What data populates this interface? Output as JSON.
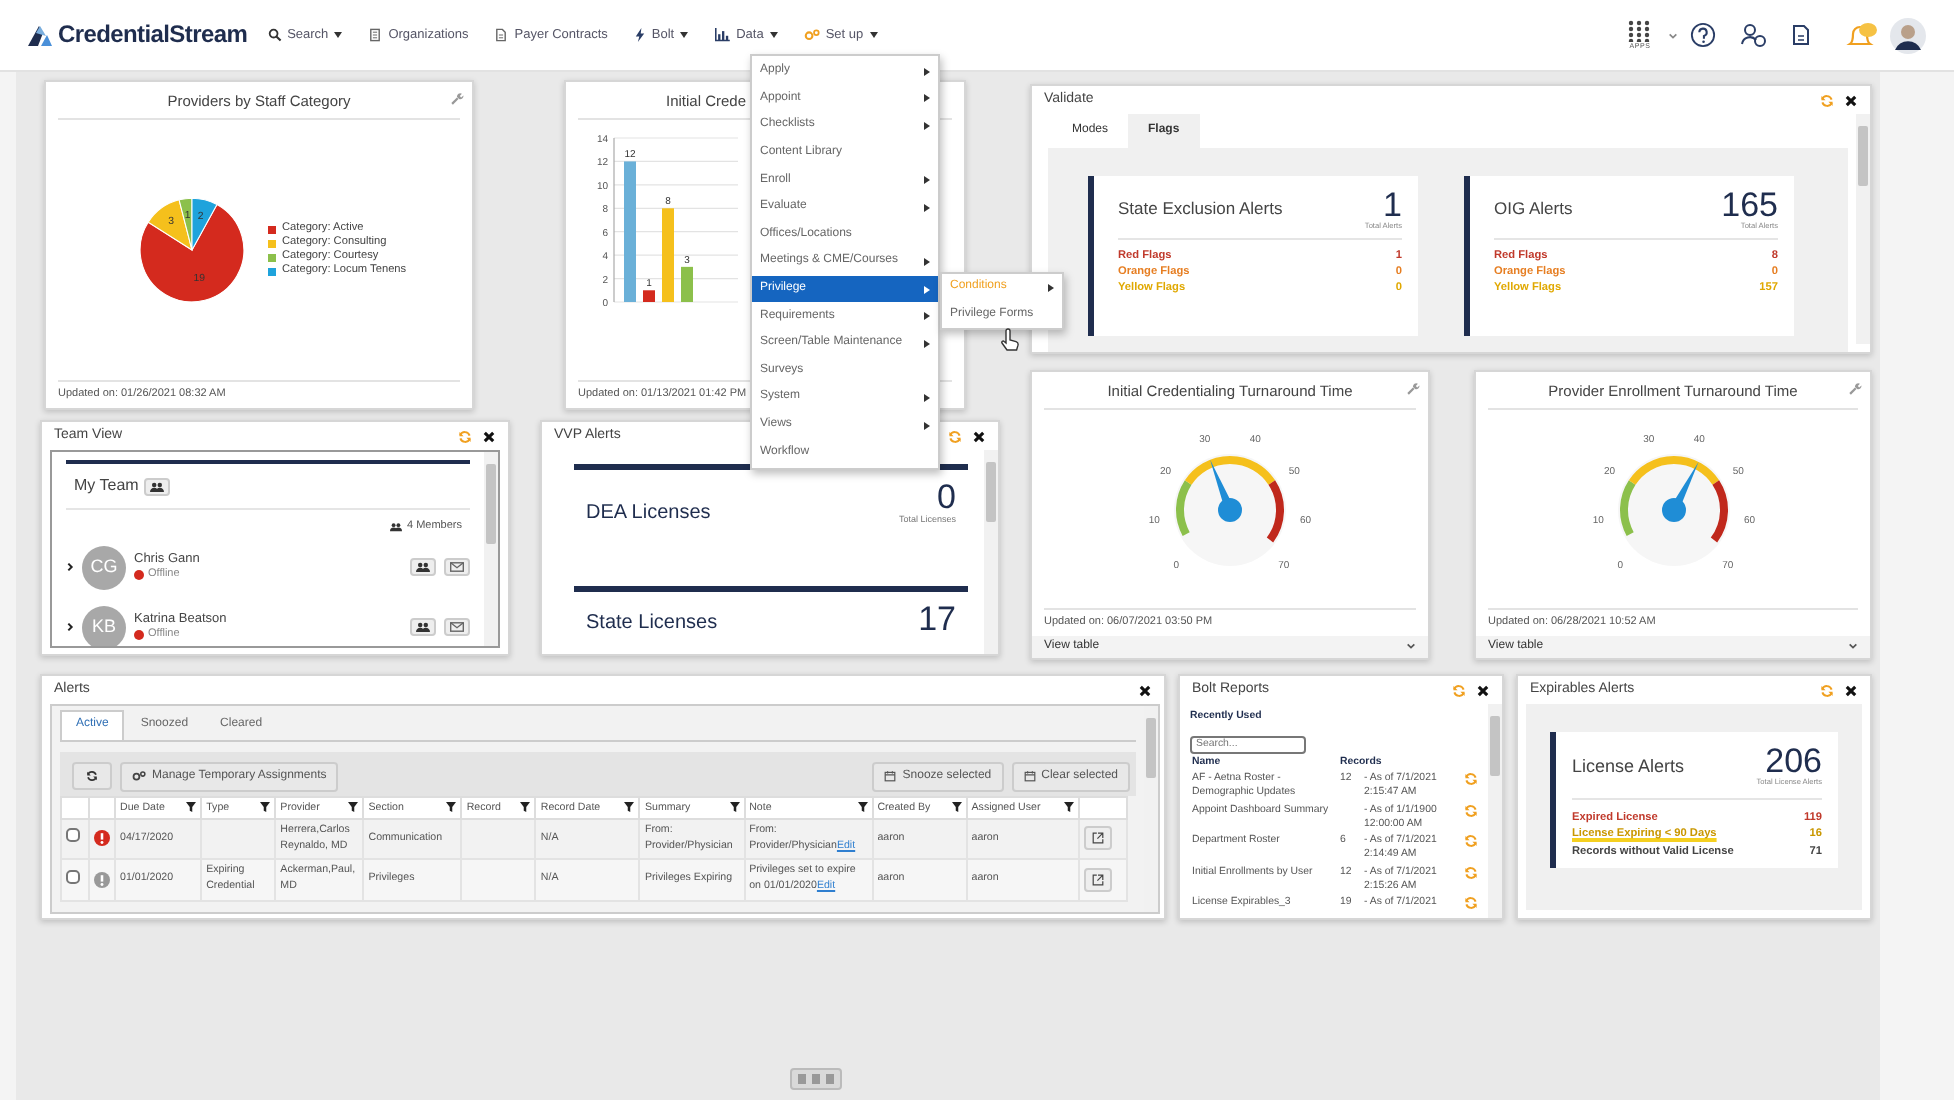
{
  "nav": {
    "brand": "CredentialStream",
    "items": [
      {
        "label": "Search",
        "kind": "search",
        "caret": true
      },
      {
        "label": "Organizations",
        "kind": "building",
        "caret": false
      },
      {
        "label": "Payer Contracts",
        "kind": "doc",
        "caret": false
      },
      {
        "label": "Bolt",
        "kind": "bolt",
        "caret": true
      },
      {
        "label": "Data",
        "kind": "chart",
        "caret": true
      },
      {
        "label": "Set up",
        "kind": "gears",
        "caret": true
      }
    ],
    "apps_label": "APPS"
  },
  "setup_menu": {
    "items": [
      {
        "label": "Apply",
        "submenu": true,
        "selected": false
      },
      {
        "label": "Appoint",
        "submenu": true,
        "selected": false
      },
      {
        "label": "Checklists",
        "submenu": true,
        "selected": false
      },
      {
        "label": "Content Library",
        "submenu": false,
        "selected": false
      },
      {
        "label": "Enroll",
        "submenu": true,
        "selected": false
      },
      {
        "label": "Evaluate",
        "submenu": true,
        "selected": false
      },
      {
        "label": "Offices/Locations",
        "submenu": false,
        "selected": false
      },
      {
        "label": "Meetings & CME/Courses",
        "submenu": true,
        "selected": false
      },
      {
        "label": "Privilege",
        "submenu": true,
        "selected": true
      },
      {
        "label": "Requirements",
        "submenu": true,
        "selected": false
      },
      {
        "label": "Screen/Table Maintenance",
        "submenu": true,
        "selected": false
      },
      {
        "label": "Surveys",
        "submenu": false,
        "selected": false
      },
      {
        "label": "System",
        "submenu": true,
        "selected": false
      },
      {
        "label": "Views",
        "submenu": true,
        "selected": false
      },
      {
        "label": "Workflow",
        "submenu": false,
        "selected": false
      }
    ],
    "submenu": [
      {
        "label": "Conditions",
        "submenu": true,
        "selected": true
      },
      {
        "label": "Privilege Forms",
        "submenu": false,
        "selected": false
      }
    ]
  },
  "staff_category": {
    "title": "Providers by Staff Category",
    "updated": "Updated on: 01/26/2021 08:32 AM",
    "chart_data": {
      "type": "pie",
      "categories": [
        "Category: Active",
        "Category: Consulting",
        "Category: Courtesy",
        "Category: Locum Tenens"
      ],
      "series": [
        {
          "values": [
            19,
            3,
            1,
            2
          ]
        }
      ],
      "colors": [
        "#d42a1e",
        "#f5c01c",
        "#8cc04b",
        "#1fa3dc"
      ],
      "data_labels": true
    }
  },
  "initial_cred": {
    "title": "Initial Crede",
    "updated": "Updated on: 01/13/2021 01:42 PM",
    "chart_data": {
      "type": "bar",
      "ylim": [
        0,
        14
      ],
      "grid": true,
      "yticks": [
        0,
        2,
        4,
        6,
        8,
        10,
        12,
        14
      ],
      "data_labels": true,
      "series": [
        {
          "color": "#6ab0d8",
          "values": [
            12
          ]
        },
        {
          "color": "#d42a1e",
          "values": [
            1
          ]
        },
        {
          "color": "#f5c01c",
          "values": [
            8
          ]
        },
        {
          "color": "#8cc04b",
          "values": [
            3
          ]
        }
      ]
    }
  },
  "validate": {
    "title": "Validate",
    "tabs": [
      {
        "label": "Modes",
        "selected": false
      },
      {
        "label": "Flags",
        "selected": true
      }
    ],
    "cards": [
      {
        "title": "State Exclusion Alerts",
        "total": "1",
        "total_label": "Total Alerts",
        "flags": [
          {
            "label": "Red Flags",
            "count": "1",
            "color": "#c0392b"
          },
          {
            "label": "Orange Flags",
            "count": "0",
            "color": "#e67e22"
          },
          {
            "label": "Yellow Flags",
            "count": "0",
            "color": "#e0a800"
          }
        ]
      },
      {
        "title": "OIG Alerts",
        "total": "165",
        "total_label": "Total Alerts",
        "flags": [
          {
            "label": "Red Flags",
            "count": "8",
            "color": "#c0392b"
          },
          {
            "label": "Orange Flags",
            "count": "0",
            "color": "#e67e22"
          },
          {
            "label": "Yellow Flags",
            "count": "157",
            "color": "#e0a800"
          }
        ]
      }
    ]
  },
  "gauges": [
    {
      "title": "Initial Credentialing Turnaround Time",
      "scale": [
        "0",
        "10",
        "20",
        "30",
        "40",
        "50",
        "60",
        "70"
      ],
      "updated": "Updated on: 06/07/2021 03:50 PM",
      "footer": "View table"
    },
    {
      "title": "Provider Enrollment Turnaround Time",
      "scale": [
        "0",
        "10",
        "20",
        "30",
        "40",
        "50",
        "60",
        "70"
      ],
      "updated": "Updated on: 06/28/2021 10:52 AM",
      "footer": "View table"
    }
  ],
  "team_view": {
    "title": "Team View",
    "team": "My Team",
    "members_label": "4 Members",
    "members": [
      {
        "initials": "CG",
        "name": "Chris Gann",
        "status": "Offline",
        "online": false
      },
      {
        "initials": "KB",
        "name": "Katrina Beatson",
        "status": "Offline",
        "online": false
      }
    ]
  },
  "vvp_alerts": {
    "title": "VVP Alerts",
    "cards": [
      {
        "title": "DEA Licenses",
        "total": "0",
        "total_label": "Total Licenses"
      },
      {
        "title": "State Licenses",
        "total": "17"
      }
    ]
  },
  "alerts": {
    "title": "Alerts",
    "tabs": [
      {
        "label": "Active",
        "selected": true
      },
      {
        "label": "Snoozed",
        "selected": false
      },
      {
        "label": "Cleared",
        "selected": false
      }
    ],
    "toolbar": {
      "manage": "Manage Temporary Assignments",
      "snooze": "Snooze selected",
      "clear": "Clear selected"
    },
    "columns": [
      "Due Date",
      "Type",
      "Provider",
      "Section",
      "Record",
      "Record Date",
      "Summary",
      "Note",
      "Created By",
      "Assigned User"
    ],
    "rows": [
      {
        "checked": false,
        "kind": "high",
        "due_date": "04/17/2020",
        "type": "",
        "provider": "Herrera,Carlos Reynaldo, MD",
        "section": "Communication",
        "record": "",
        "record_date": "N/A",
        "summary": "From: Provider/Physician",
        "note": "From: Provider/Physician",
        "note_link": "Edit",
        "created_by": "aaron",
        "assigned_user": "aaron"
      },
      {
        "checked": false,
        "kind": "info",
        "due_date": "01/01/2020",
        "type": "Expiring Credential",
        "provider": "Ackerman,Paul, MD",
        "section": "Privileges",
        "record": "",
        "record_date": "N/A",
        "summary": "Privileges Expiring",
        "note": "Privileges set to expire on 01/01/2020",
        "note_link": "Edit",
        "created_by": "aaron",
        "assigned_user": "aaron"
      }
    ]
  },
  "bolt_reports": {
    "title": "Bolt Reports",
    "subtitle": "Recently Used",
    "search": {
      "placeholder": "Search..."
    },
    "columns": [
      "Name",
      "Records"
    ],
    "rows": [
      {
        "name": "AF - Aetna Roster - Demographic Updates",
        "records": "12",
        "as_of": "- As of 7/1/2021 2:15:47 AM"
      },
      {
        "name": "Appoint Dashboard Summary",
        "records": "",
        "as_of": "- As of 1/1/1900 12:00:00 AM"
      },
      {
        "name": "Department Roster",
        "records": "6",
        "as_of": "- As of 7/1/2021 2:14:49 AM"
      },
      {
        "name": "Initial Enrollments by User",
        "records": "12",
        "as_of": "- As of 7/1/2021 2:15:26 AM"
      },
      {
        "name": "License Expirables_3",
        "records": "19",
        "as_of": "- As of 7/1/2021"
      }
    ]
  },
  "expirables": {
    "title": "Expirables Alerts",
    "card_title": "License Alerts",
    "total": "206",
    "total_label": "Total License Alerts",
    "rows": [
      {
        "label": "Expired License",
        "count": "119",
        "color": "#c0392b",
        "highlighted": false
      },
      {
        "label": "License Expiring < 90 Days",
        "count": "16",
        "color": "#c99700",
        "highlighted": true
      },
      {
        "label": "Records without Valid License",
        "count": "71",
        "color": "#444444",
        "highlighted": false
      }
    ]
  }
}
